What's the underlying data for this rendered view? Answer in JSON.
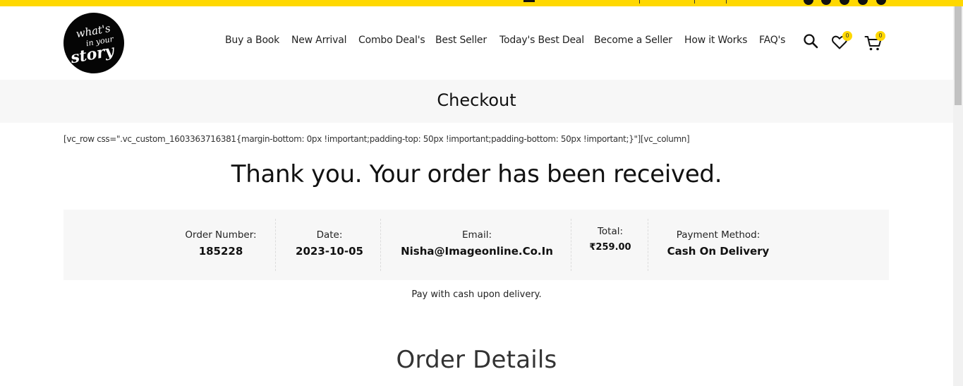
{
  "brand": {
    "logo_text": "what's in your story",
    "accent_color": "#ffd800"
  },
  "nav": {
    "items": [
      {
        "label": "Buy a Book"
      },
      {
        "label": "New Arrival"
      },
      {
        "label": "Combo Deal's"
      },
      {
        "label": "Best Seller"
      },
      {
        "label": "Today's Best Deal"
      },
      {
        "label": "Become a Seller"
      },
      {
        "label": "How it Works"
      },
      {
        "label": "FAQ's"
      }
    ],
    "icons": {
      "search": "search-icon",
      "wishlist": "heart-icon",
      "cart": "cart-icon"
    },
    "wishlist_count": "0",
    "cart_count": "0"
  },
  "page": {
    "title": "Checkout",
    "shortcode": "[vc_row css=\".vc_custom_1603363716381{margin-bottom: 0px !important;padding-top: 50px !important;padding-bottom: 50px !important;}\"][vc_column]",
    "thank_you": "Thank you. Your order has been received.",
    "pay_note": "Pay with cash upon delivery.",
    "order_details_heading": "Order Details"
  },
  "order": {
    "number_label": "Order Number:",
    "number": "185228",
    "date_label": "Date:",
    "date": "2023-10-05",
    "email_label": "Email:",
    "email": "Nisha@Imageonline.Co.In",
    "total_label": "Total:",
    "total": "₹259.00",
    "payment_label": "Payment Method:",
    "payment": "Cash On Delivery"
  }
}
